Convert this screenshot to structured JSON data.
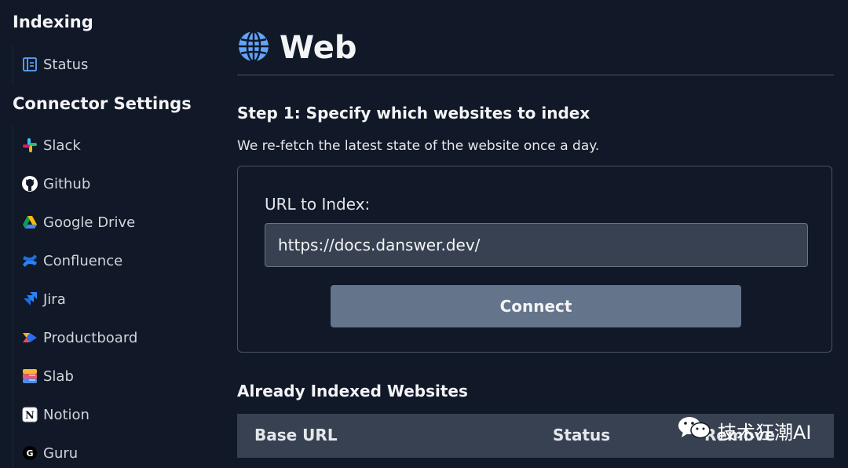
{
  "sidebar": {
    "indexing_title": "Indexing",
    "indexing_items": [
      {
        "label": "Status",
        "icon": "status-icon"
      }
    ],
    "connector_title": "Connector Settings",
    "connector_items": [
      {
        "label": "Slack",
        "icon": "slack-icon"
      },
      {
        "label": "Github",
        "icon": "github-icon"
      },
      {
        "label": "Google Drive",
        "icon": "google-drive-icon"
      },
      {
        "label": "Confluence",
        "icon": "confluence-icon"
      },
      {
        "label": "Jira",
        "icon": "jira-icon"
      },
      {
        "label": "Productboard",
        "icon": "productboard-icon"
      },
      {
        "label": "Slab",
        "icon": "slab-icon"
      },
      {
        "label": "Notion",
        "icon": "notion-icon"
      },
      {
        "label": "Guru",
        "icon": "guru-icon"
      }
    ]
  },
  "main": {
    "title": "Web",
    "title_icon": "globe-icon",
    "step_title": "Step 1: Specify which websites to index",
    "step_description": "We re-fetch the latest state of the website once a day.",
    "url_label": "URL to Index:",
    "url_value": "https://docs.danswer.dev/",
    "connect_label": "Connect",
    "indexed_title": "Already Indexed Websites",
    "table_headers": [
      "Base URL",
      "Status",
      "Remove"
    ]
  },
  "watermark": {
    "text": "技术狂潮AI",
    "icon": "wechat-icon"
  },
  "colors": {
    "background": "#111827",
    "input_background": "#374151",
    "button": "#64748b",
    "globe": "#60a5fa"
  }
}
